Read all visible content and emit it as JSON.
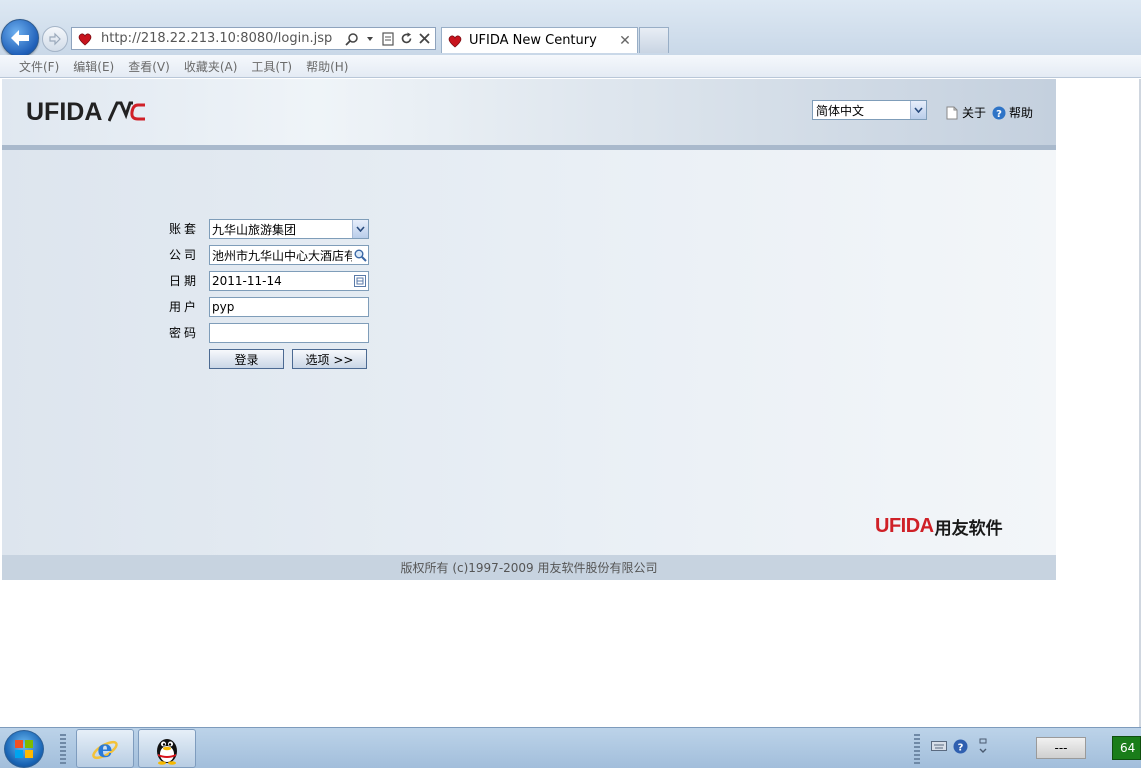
{
  "browser": {
    "url": "http://218.22.213.10:8080/login.jsp",
    "tab_title": "UFIDA New Century",
    "menu": [
      "文件(F)",
      "编辑(E)",
      "查看(V)",
      "收藏夹(A)",
      "工具(T)",
      "帮助(H)"
    ]
  },
  "header": {
    "logo_text": "UFIDA",
    "language_value": "简体中文",
    "about_label": "关于",
    "help_label": "帮助"
  },
  "login_form": {
    "account_label": "账套",
    "account_value": "九华山旅游集团",
    "company_label": "公司",
    "company_value": "池州市九华山中心大酒店有",
    "date_label": "日期",
    "date_value": "2011-11-14",
    "user_label": "用户",
    "user_value": "pyp",
    "password_label": "密码",
    "password_value": "",
    "login_button": "登录",
    "options_button": "选项 >>"
  },
  "brand": {
    "en": "UFIDA",
    "cn": "用友软件"
  },
  "footer": {
    "copyright": "版权所有  (c)1997-2009 用友软件股份有限公司"
  },
  "taskbar": {
    "status_box": "---",
    "battery_text": "64"
  }
}
